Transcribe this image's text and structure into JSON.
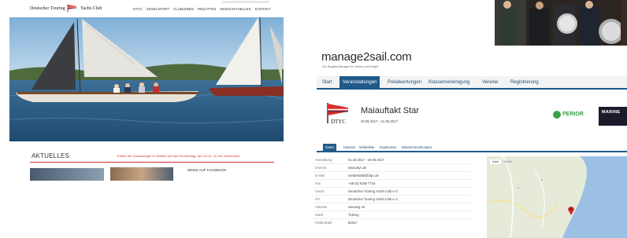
{
  "left_site": {
    "brand_prefix": "Deutscher Touring",
    "brand_suffix": "Yacht-Club",
    "menu": [
      "DTYC",
      "SEGELSPORT",
      "CLUBLEBEN",
      "REGATTEN",
      "NEWS/AKTUELLES",
      "KONTAKT"
    ],
    "section_title": "AKTUELLES",
    "highlight_news": "Treffen der Classicsegler im Stüberl wird auf Donnerstag, den 25.12. 19 Uhr verschoben",
    "facebook_label": "NEWS AUF FACEBOOK"
  },
  "right_site": {
    "logo": "manage2sail.com",
    "tagline": "Der Regatta Manager für Vereine und Segler",
    "nav": [
      "Start",
      "Veranstaltungen",
      "Pokalwertungen",
      "Klassenvereinigung",
      "Vereine",
      "Registrierung"
    ],
    "nav_active_index": 1,
    "event_logo_text": "DTYC",
    "event_title": "Maiauftakt Star",
    "event_dates": "20.05.2017 - 21.05.2017",
    "sponsors": [
      "PERIOR",
      "MARINE"
    ],
    "tabs": [
      "Daten",
      "Klassen",
      "Meldeliste",
      "Ergebnisse",
      "Bekanntmachungen"
    ],
    "tabs_active_index": 0,
    "info_rows": [
      {
        "key": "Anmeldung",
        "value": "01.03.2017 - 19.05.2017"
      },
      {
        "key": "Internet",
        "value": "www.dtyc.de"
      },
      {
        "key": "E-Mail",
        "value": "meldestelle@dtyc.de"
      },
      {
        "key": "Fax",
        "value": "+49 (0) 8158 7719"
      },
      {
        "key": "Verein",
        "value": "Deutscher Touring Yacht-Club e.V."
      },
      {
        "key": "Ort",
        "value": "Deutscher Touring Yacht-Club e.V."
      },
      {
        "key": "Adresse",
        "value": "Seeweg 19"
      },
      {
        "key": "Stadt",
        "value": "Tutzing"
      },
      {
        "key": "Postleitzahl",
        "value": "82327"
      }
    ],
    "map_tabs": [
      "Karte",
      "Satellit"
    ]
  },
  "colors": {
    "dtyc_red": "#d8302c",
    "m2s_blue": "#1f5a8a",
    "perior_green": "#3aa14b"
  }
}
